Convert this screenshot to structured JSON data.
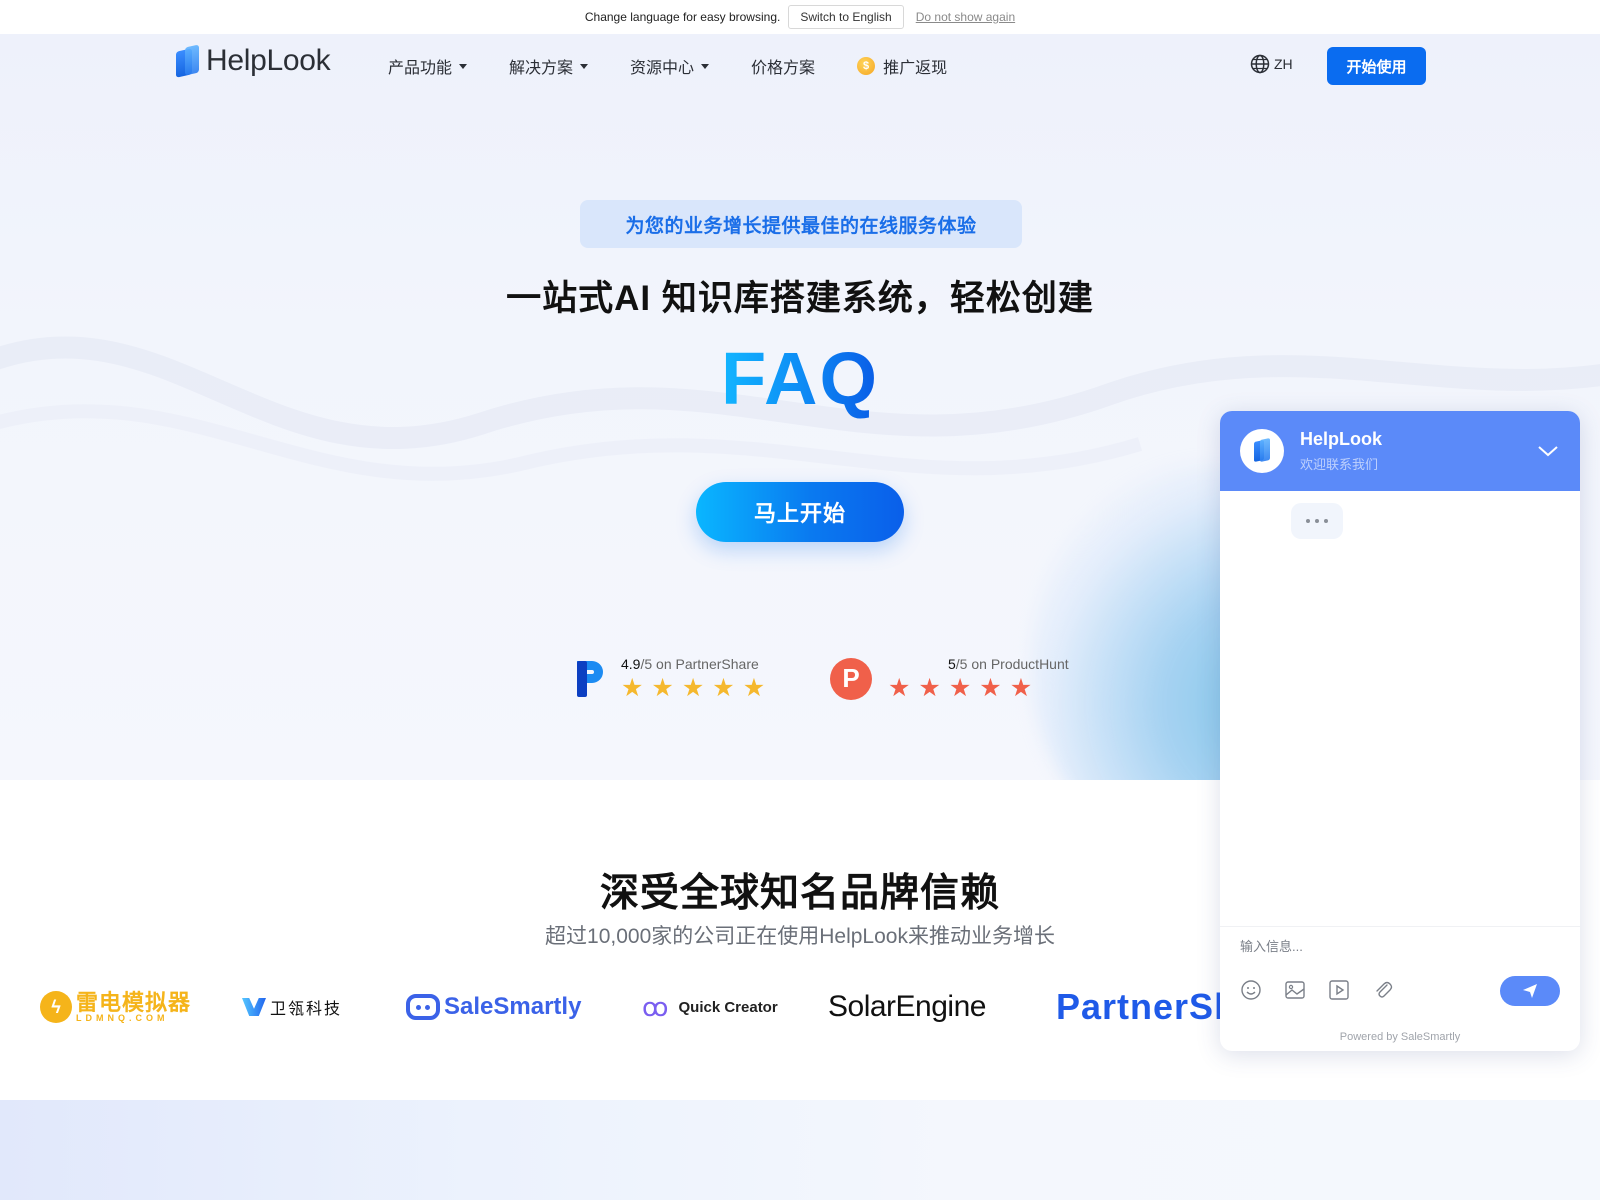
{
  "lang_bar": {
    "message": "Change language for easy browsing.",
    "switch_label": "Switch to English",
    "dismiss_label": "Do not show again"
  },
  "nav": {
    "logo": "HelpLook",
    "items": [
      {
        "label": "产品功能",
        "has_dropdown": true
      },
      {
        "label": "解决方案",
        "has_dropdown": true
      },
      {
        "label": "资源中心",
        "has_dropdown": true
      },
      {
        "label": "价格方案",
        "has_dropdown": false
      },
      {
        "label": "推广返现",
        "has_dropdown": false,
        "icon": "coin-icon"
      }
    ],
    "coin_symbol": "$",
    "language": "ZH",
    "cta_label": "开始使用"
  },
  "hero": {
    "tagline": "为您的业务增长提供最佳的在线服务体验",
    "headline": "一站式AI 知识库搭建系统，轻松创建",
    "highlight": "FAQ",
    "cta_label": "马上开始"
  },
  "ratings": [
    {
      "score": "4.9",
      "suffix": "/5 on PartnerShare",
      "stars": 5,
      "star_color": "#f5b82e",
      "logo": "P"
    },
    {
      "score": "5",
      "suffix": "/5 on ProductHunt",
      "stars": 5,
      "star_color": "#f0604a",
      "logo": "P"
    }
  ],
  "trusted": {
    "title": "深受全球知名品牌信赖",
    "subtitle": "超过10,000家的公司正在使用HelpLook来推动业务增长",
    "brands": [
      {
        "name": "雷电模拟器",
        "sub": "LDMNQ.COM"
      },
      {
        "name": "卫瓴科技"
      },
      {
        "name": "SaleSmartly"
      },
      {
        "name": "Quick Creator"
      },
      {
        "name": "SolarEngine"
      },
      {
        "name": "PartnerSh"
      }
    ]
  },
  "chat": {
    "title": "HelpLook",
    "subtitle": "欢迎联系我们",
    "input_placeholder": "输入信息...",
    "powered_by": "Powered by SaleSmartly",
    "accent": "#5b8af9"
  },
  "colors": {
    "primary": "#0a6cf0",
    "tagline_text": "#1a6ee8",
    "tagline_bg": "#d9e6fb"
  }
}
